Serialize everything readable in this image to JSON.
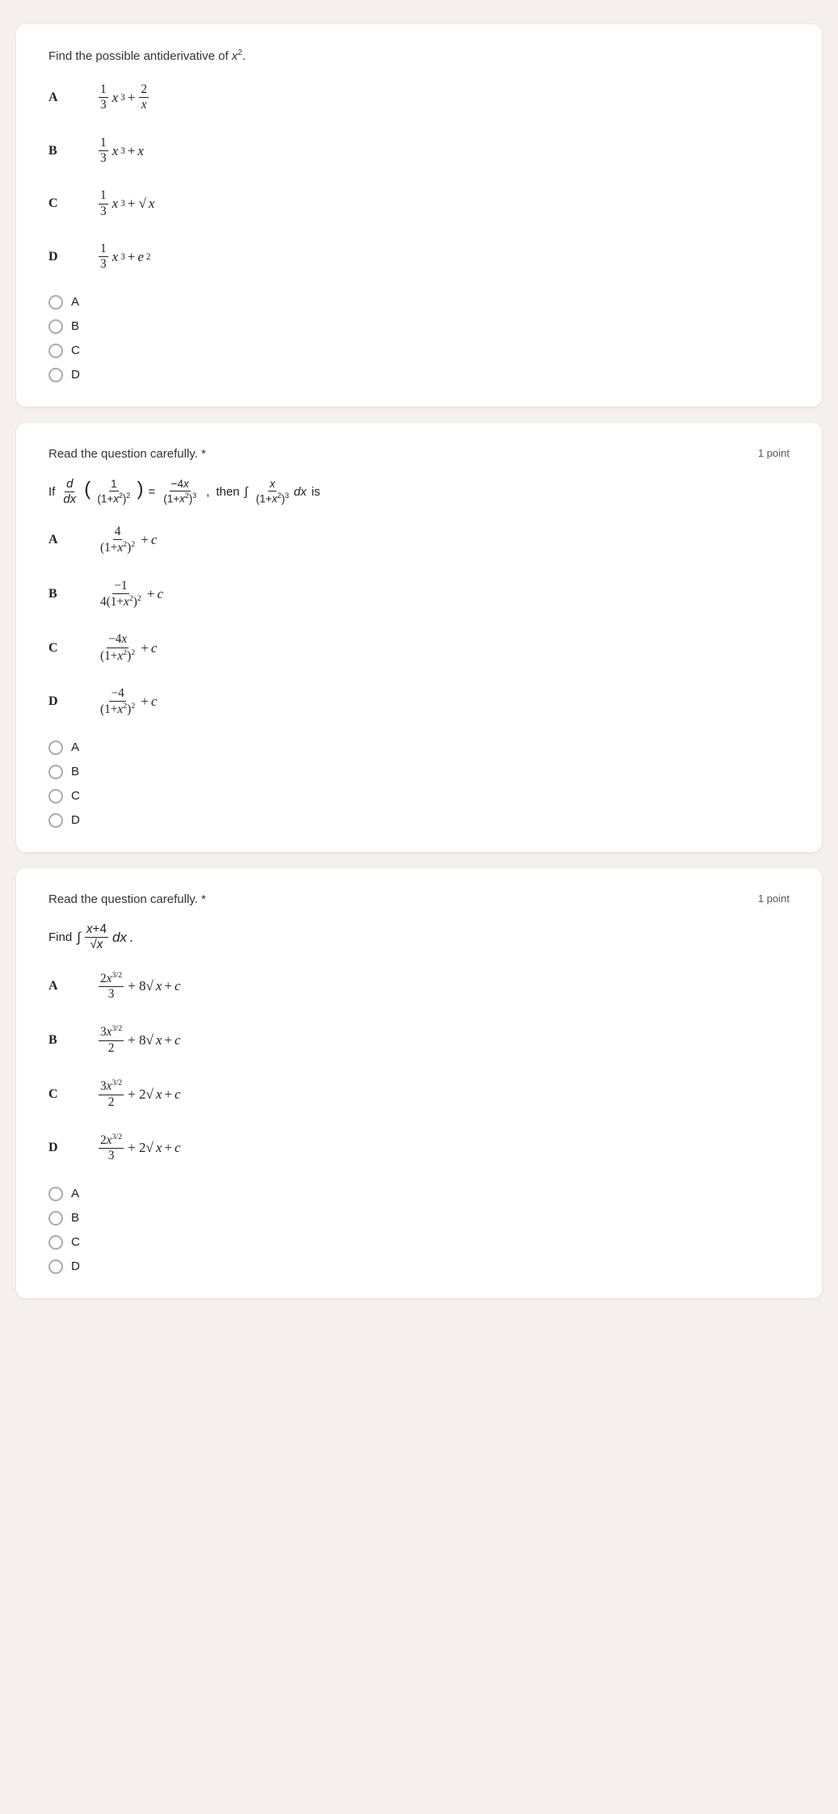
{
  "question1": {
    "header": "Find the possible antiderivative of x².",
    "choices": [
      {
        "label": "A",
        "mathHtml": "A_math"
      },
      {
        "label": "B",
        "mathHtml": "B_math"
      },
      {
        "label": "C",
        "mathHtml": "C_math"
      },
      {
        "label": "D",
        "mathHtml": "D_math"
      }
    ],
    "radio_options": [
      "A",
      "B",
      "C",
      "D"
    ]
  },
  "question2": {
    "card_title": "Read the question carefully. *",
    "points": "1 point",
    "radio_options": [
      "A",
      "B",
      "C",
      "D"
    ]
  },
  "question3": {
    "card_title": "Read the question carefully. *",
    "points": "1 point",
    "radio_options": [
      "A",
      "B",
      "C",
      "D"
    ]
  }
}
